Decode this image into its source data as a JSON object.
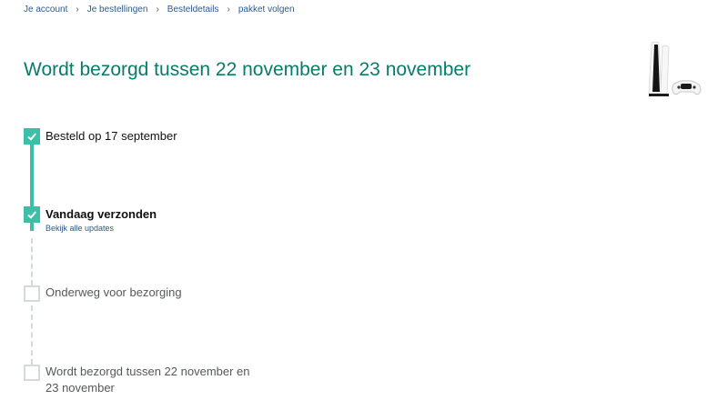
{
  "breadcrumb": {
    "items": [
      "Je account",
      "Je bestellingen",
      "Besteldetails",
      "pakket volgen"
    ],
    "separator": "›"
  },
  "title": "Wordt bezorgd tussen 22 november en 23 november",
  "product": {
    "image": "playstation-5-console-with-controller"
  },
  "steps": [
    {
      "label": "Besteld op 17 september",
      "status": "done"
    },
    {
      "label": "Vandaag verzonden",
      "status": "done",
      "link": "Bekijk alle updates"
    },
    {
      "label": "Onderweg voor bezorging",
      "status": "pending"
    },
    {
      "label_line1": "Wordt bezorgd tussen 22 november en",
      "label_line2": "23 november",
      "status": "pending"
    }
  ],
  "colors": {
    "accent": "#3dbfa7",
    "title": "#067d68",
    "link": "#2a5a8c",
    "pending": "#d5d9d9"
  }
}
